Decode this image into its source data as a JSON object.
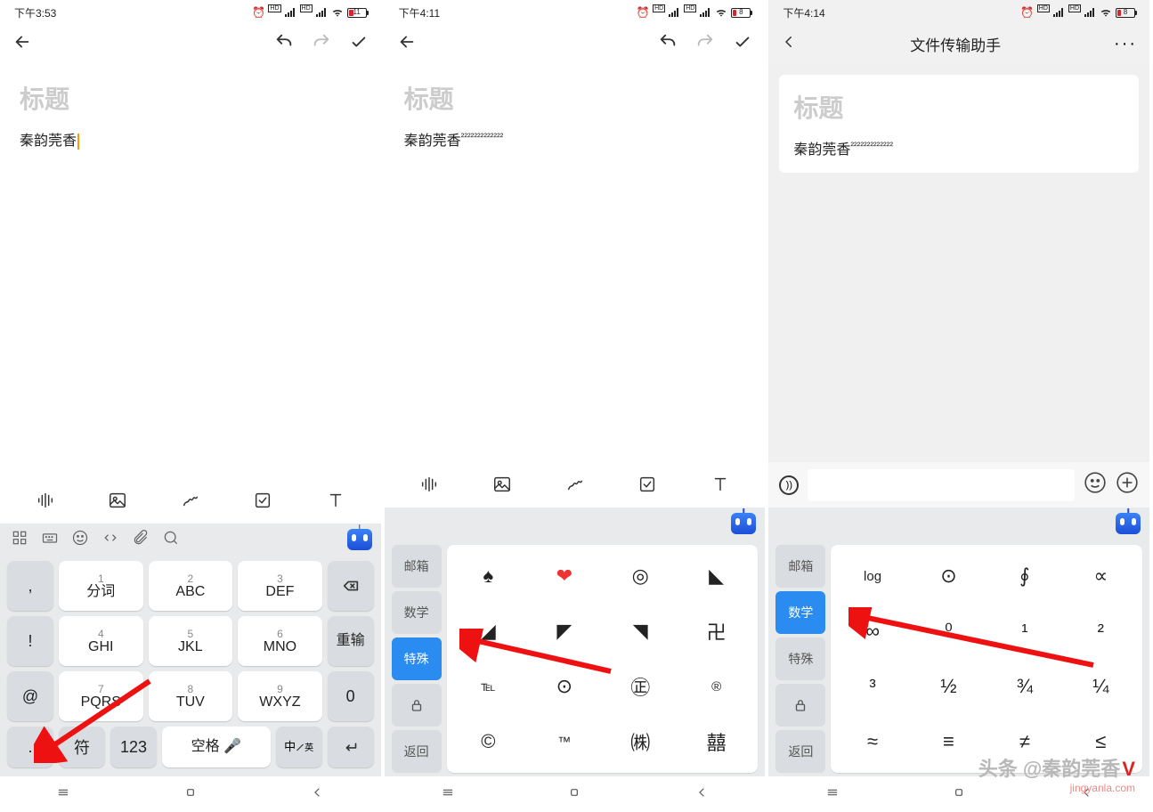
{
  "panel1": {
    "status": {
      "time": "下午3:53",
      "battery": "11"
    },
    "title_placeholder": "标题",
    "content": "秦韵莞香",
    "toolbar_icons": [
      "voice",
      "image",
      "handwrite",
      "checkbox",
      "text"
    ],
    "keyboard_top": [
      "grid",
      "keyboard",
      "emoji",
      "code",
      "attach",
      "search"
    ],
    "t9": {
      "side_left": [
        ",",
        "!",
        "@",
        "."
      ],
      "keys": [
        {
          "num": "1",
          "lbl": "分词"
        },
        {
          "num": "2",
          "lbl": "ABC"
        },
        {
          "num": "3",
          "lbl": "DEF"
        },
        {
          "num": "4",
          "lbl": "GHI"
        },
        {
          "num": "5",
          "lbl": "JKL"
        },
        {
          "num": "6",
          "lbl": "MNO"
        },
        {
          "num": "7",
          "lbl": "PQRS"
        },
        {
          "num": "8",
          "lbl": "TUV"
        },
        {
          "num": "9",
          "lbl": "WXYZ"
        }
      ],
      "zero": "0",
      "side_right_del": "⌫",
      "side_right_retype": "重输",
      "bottom": {
        "symbols": "符",
        "num": "123",
        "space": "空格",
        "lang_zh": "中",
        "lang_en": "英"
      }
    }
  },
  "panel2": {
    "status": {
      "time": "下午4:11",
      "battery": "8"
    },
    "title_placeholder": "标题",
    "content_main": "秦韵莞香",
    "content_sup": "²²²²²²²²²²²²²",
    "cats": [
      "邮箱",
      "数学",
      "特殊"
    ],
    "cat_lock": "lock",
    "cat_back": "返回",
    "active_cat": 2,
    "symbols": [
      "♠",
      "❤",
      "◎",
      "◣",
      "◢",
      "◤",
      "◥",
      "卍",
      "℡",
      "⊙",
      "㊣",
      "®",
      "©",
      "™",
      "㈱",
      "囍"
    ]
  },
  "panel3": {
    "status": {
      "time": "下午4:14",
      "battery": "8"
    },
    "header_title": "文件传输助手",
    "title_placeholder": "标题",
    "content_main": "秦韵莞香",
    "content_sup": "²²²²²²²²²²²²²",
    "cats": [
      "邮箱",
      "数学",
      "特殊"
    ],
    "cat_back": "返回",
    "active_cat": 1,
    "symbols": [
      "log",
      "⊙",
      "∮",
      "∝",
      "∞",
      "⁰",
      "¹",
      "²",
      "³",
      "½",
      "¾",
      "¼",
      "≈",
      "≡",
      "≠",
      "≤"
    ]
  },
  "watermark": {
    "main": "头条 @秦韵莞香",
    "v": "V",
    "sub": "jingyanla.com"
  }
}
